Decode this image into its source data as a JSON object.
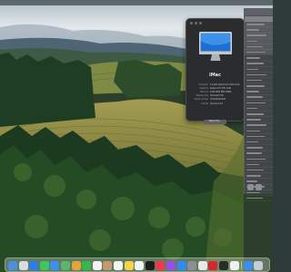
{
  "about_window": {
    "model": "iMac",
    "specs": [
      {
        "label": "Processor",
        "value": "3.4 GHz Quad-Core Intel Core i5"
      },
      {
        "label": "Graphics",
        "value": "Radeon Pro 570 4 GB"
      },
      {
        "label": "Memory",
        "value": "8 GB 2400 MHz DDR4"
      },
      {
        "label": "Startup disk",
        "value": "Macintosh HD"
      },
      {
        "label": "Serial number",
        "value": "C02VX0XXXXXX"
      },
      {
        "label": "macOS",
        "value": "Sonoma 14.0"
      }
    ],
    "more_info_label": "More Info...",
    "legal_line1": "Regulatory Certification",
    "legal_line2": "™ and © 1983–2023 Apple Inc.",
    "legal_line3": "All Rights Reserved."
  },
  "dock": {
    "apps": [
      {
        "name": "finder-icon",
        "color": "#4a8fe0"
      },
      {
        "name": "launchpad-icon",
        "color": "#d9dde3"
      },
      {
        "name": "safari-icon",
        "color": "#2d7ce8"
      },
      {
        "name": "messages-icon",
        "color": "#3cc85a"
      },
      {
        "name": "mail-icon",
        "color": "#3b8ff0"
      },
      {
        "name": "maps-icon",
        "color": "#5bb56b"
      },
      {
        "name": "photos-icon",
        "color": "#e8a23a"
      },
      {
        "name": "facetime-icon",
        "color": "#34b84a"
      },
      {
        "name": "calendar-icon",
        "color": "#f2f2f2"
      },
      {
        "name": "contacts-icon",
        "color": "#c49a6c"
      },
      {
        "name": "reminders-icon",
        "color": "#f4f4f4"
      },
      {
        "name": "notes-icon",
        "color": "#f6d44a"
      },
      {
        "name": "freeform-icon",
        "color": "#f3f3f3"
      },
      {
        "name": "tv-icon",
        "color": "#1d1d1f"
      },
      {
        "name": "music-icon",
        "color": "#f2374f"
      },
      {
        "name": "podcasts-icon",
        "color": "#9c4de8"
      },
      {
        "name": "app-store-icon",
        "color": "#2f8af5"
      },
      {
        "name": "system-settings-icon",
        "color": "#8e8e93"
      },
      {
        "name": "textedit-icon",
        "color": "#e9e9ea"
      },
      {
        "name": "keynote-icon",
        "color": "#d8262e"
      },
      {
        "name": "terminal-icon",
        "color": "#2b2b2b"
      },
      {
        "name": "preview-icon",
        "color": "#f0f0f0"
      }
    ],
    "folders": [
      {
        "name": "downloads-folder-icon",
        "color": "#3b8df0"
      },
      {
        "name": "trash-icon",
        "color": "#c7ccd1"
      }
    ]
  },
  "colors": {
    "window_bg": "#2b2c2e",
    "side_panel_bg": "#4a4c50",
    "sky": "#dce3e8",
    "hills": "#4f6a5c",
    "vineyard": "#8f8a3c",
    "forest": "#1f3d22"
  }
}
